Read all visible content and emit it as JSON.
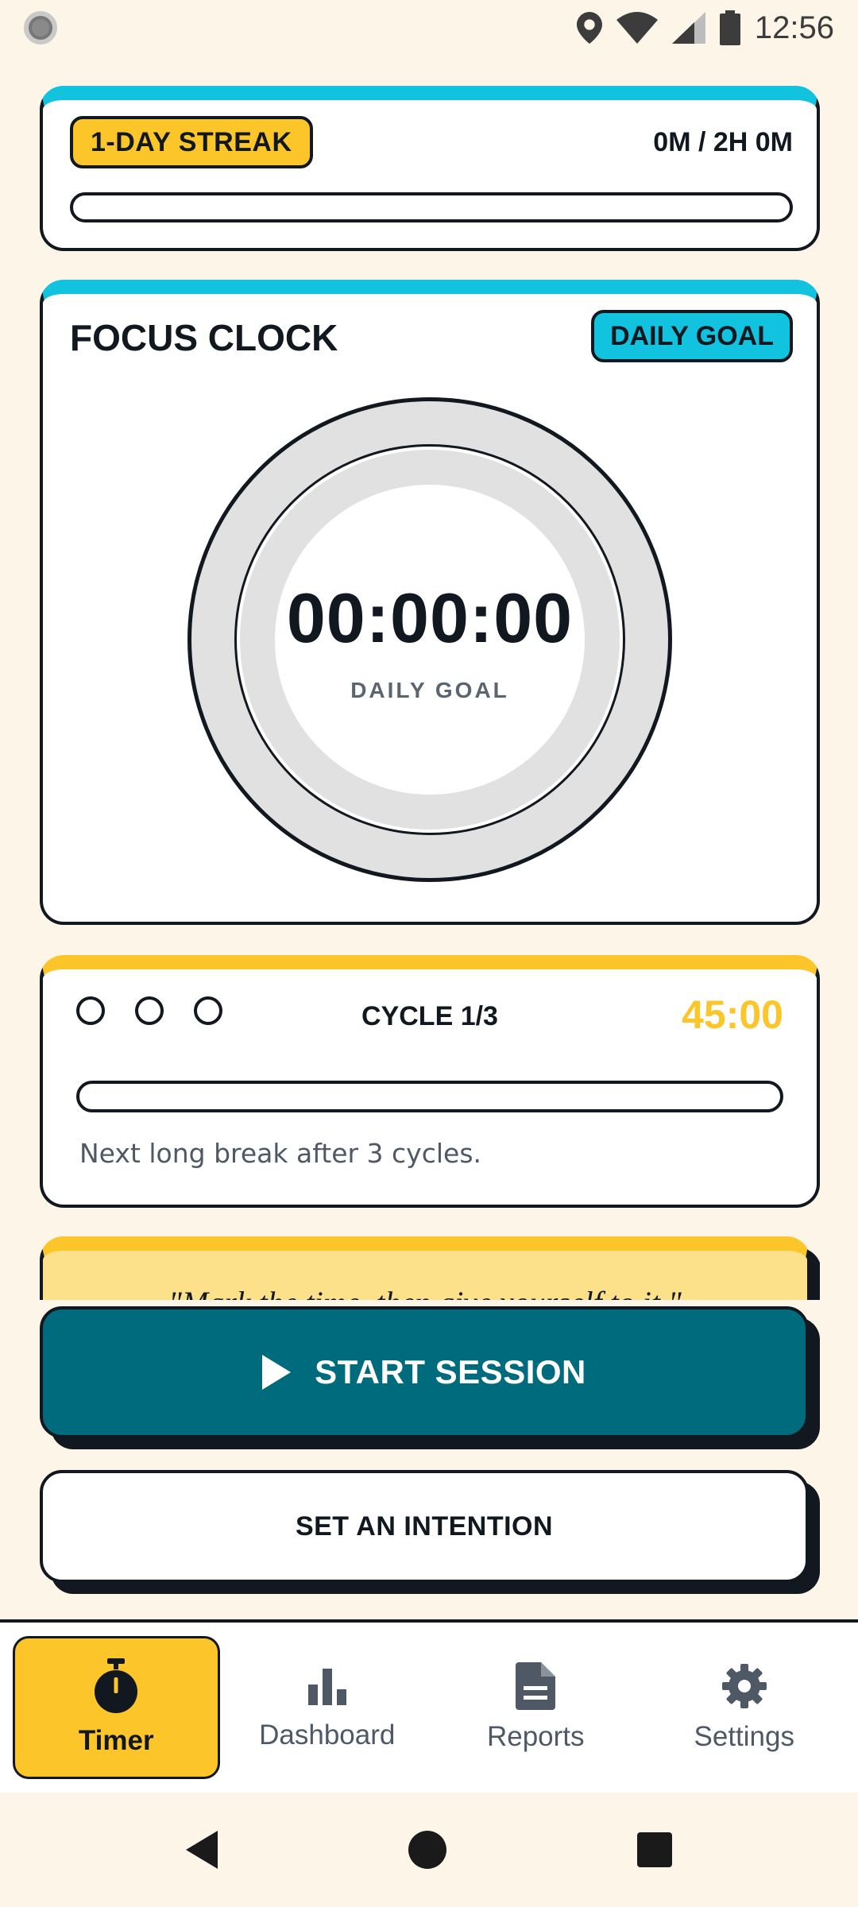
{
  "status_bar": {
    "time": "12:56",
    "icons": [
      "notification-dot-icon",
      "location-icon",
      "wifi-icon",
      "signal-icon",
      "battery-icon"
    ]
  },
  "streak": {
    "badge": "1-DAY STREAK",
    "progress_text": "0M / 2H 0M",
    "progress_fraction": 0
  },
  "focus_clock": {
    "title": "FOCUS CLOCK",
    "badge": "DAILY GOAL",
    "time": "00:00:00",
    "caption": "DAILY GOAL"
  },
  "cycle": {
    "label": "CYCLE 1/3",
    "time": "45:00",
    "completed": 0,
    "total": 3,
    "progress_fraction": 0,
    "note": "Next long break after 3 cycles."
  },
  "quote": {
    "text": "\"Mark the time, then give yourself to it.\""
  },
  "actions": {
    "start_label": "START SESSION",
    "intention_label": "SET AN INTENTION"
  },
  "nav": {
    "items": [
      {
        "label": "Timer",
        "icon": "stopwatch-icon",
        "active": true
      },
      {
        "label": "Dashboard",
        "icon": "bar-chart-icon",
        "active": false
      },
      {
        "label": "Reports",
        "icon": "document-icon",
        "active": false
      },
      {
        "label": "Settings",
        "icon": "gear-icon",
        "active": false
      }
    ]
  },
  "colors": {
    "background": "#fdf6e8",
    "cyan": "#12c3e0",
    "yellow": "#fcc62b",
    "teal": "#006b7d",
    "ink": "#111820"
  }
}
